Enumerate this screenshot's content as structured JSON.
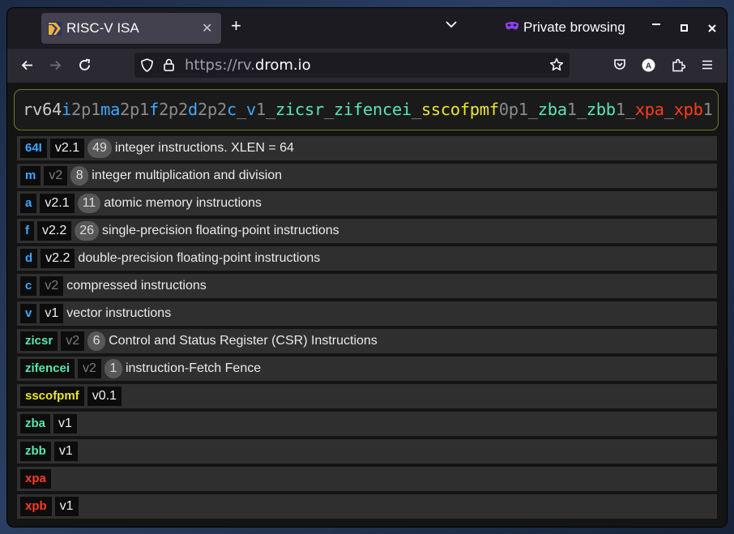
{
  "browser": {
    "tab_title": "RISC-V ISA",
    "tab_close": "✕",
    "new_tab": "+",
    "private_label": "Private browsing",
    "url_scheme": "https://rv.",
    "url_host": "drom.io",
    "icons": [
      "back-icon",
      "forward-icon",
      "reload-icon",
      "shield-icon",
      "lock-icon",
      "bookmark-star-icon",
      "pocket-icon",
      "account-icon",
      "extensions-icon",
      "menu-icon"
    ]
  },
  "isa": {
    "segments": [
      {
        "text": "rv",
        "color": "#c8c8c8"
      },
      {
        "text": "64",
        "color": "#c8c8c8"
      },
      {
        "text": "i",
        "color": "#3ea8ff"
      },
      {
        "text": "2p1",
        "color": "#8a8a8a"
      },
      {
        "text": "m",
        "color": "#3ea8ff"
      },
      {
        "text": "a",
        "color": "#3ea8ff"
      },
      {
        "text": "2p1",
        "color": "#8a8a8a"
      },
      {
        "text": "f",
        "color": "#3ea8ff"
      },
      {
        "text": "2p2",
        "color": "#8a8a8a"
      },
      {
        "text": "d",
        "color": "#3ea8ff"
      },
      {
        "text": "2p2",
        "color": "#8a8a8a"
      },
      {
        "text": "c",
        "color": "#3ea8ff"
      },
      {
        "text": "_",
        "color": "#8a8a8a"
      },
      {
        "text": "v",
        "color": "#3ea8ff"
      },
      {
        "text": "1",
        "color": "#8a8a8a"
      },
      {
        "text": "_",
        "color": "#8a8a8a"
      },
      {
        "text": "zicsr",
        "color": "#59e6b0"
      },
      {
        "text": "_",
        "color": "#8a8a8a"
      },
      {
        "text": "zifencei",
        "color": "#59e6b0"
      },
      {
        "text": "_",
        "color": "#8a8a8a"
      },
      {
        "text": "sscofpmf",
        "color": "#e8e62e"
      },
      {
        "text": "0p1",
        "color": "#8a8a8a"
      },
      {
        "text": "_",
        "color": "#8a8a8a"
      },
      {
        "text": "zba",
        "color": "#59e6b0"
      },
      {
        "text": "1",
        "color": "#8a8a8a"
      },
      {
        "text": "_",
        "color": "#8a8a8a"
      },
      {
        "text": "zbb",
        "color": "#59e6b0"
      },
      {
        "text": "1",
        "color": "#8a8a8a"
      },
      {
        "text": "_",
        "color": "#8a8a8a"
      },
      {
        "text": "xpa",
        "color": "#ff3b1f"
      },
      {
        "text": "_",
        "color": "#8a8a8a"
      },
      {
        "text": "xpb",
        "color": "#ff3b1f"
      },
      {
        "text": "1",
        "color": "#8a8a8a"
      }
    ]
  },
  "extensions": [
    {
      "name": "64I",
      "color": "blue",
      "version": "v2.1",
      "dim": false,
      "count": "49",
      "desc": "integer instructions. XLEN = 64"
    },
    {
      "name": "m",
      "color": "blue",
      "version": "v2",
      "dim": true,
      "count": "8",
      "desc": "integer multiplication and division"
    },
    {
      "name": "a",
      "color": "blue",
      "version": "v2.1",
      "dim": false,
      "count": "11",
      "desc": "atomic memory instructions"
    },
    {
      "name": "f",
      "color": "blue",
      "version": "v2.2",
      "dim": false,
      "count": "26",
      "desc": "single-precision floating-point instructions"
    },
    {
      "name": "d",
      "color": "blue",
      "version": "v2.2",
      "dim": false,
      "count": "",
      "desc": "double-precision floating-point instructions"
    },
    {
      "name": "c",
      "color": "blue",
      "version": "v2",
      "dim": true,
      "count": "",
      "desc": "compressed instructions"
    },
    {
      "name": "v",
      "color": "blue",
      "version": "v1",
      "dim": false,
      "count": "",
      "desc": "vector instructions"
    },
    {
      "name": "zicsr",
      "color": "green",
      "version": "v2",
      "dim": true,
      "count": "6",
      "desc": "Control and Status Register (CSR) Instructions"
    },
    {
      "name": "zifencei",
      "color": "green",
      "version": "v2",
      "dim": true,
      "count": "1",
      "desc": "instruction-Fetch Fence"
    },
    {
      "name": "sscofpmf",
      "color": "yellow",
      "version": "v0.1",
      "dim": false,
      "count": "",
      "desc": ""
    },
    {
      "name": "zba",
      "color": "green",
      "version": "v1",
      "dim": false,
      "count": "",
      "desc": ""
    },
    {
      "name": "zbb",
      "color": "green",
      "version": "v1",
      "dim": false,
      "count": "",
      "desc": ""
    },
    {
      "name": "xpa",
      "color": "red",
      "version": "",
      "dim": false,
      "count": "",
      "desc": ""
    },
    {
      "name": "xpb",
      "color": "red",
      "version": "v1",
      "dim": false,
      "count": "",
      "desc": ""
    }
  ]
}
